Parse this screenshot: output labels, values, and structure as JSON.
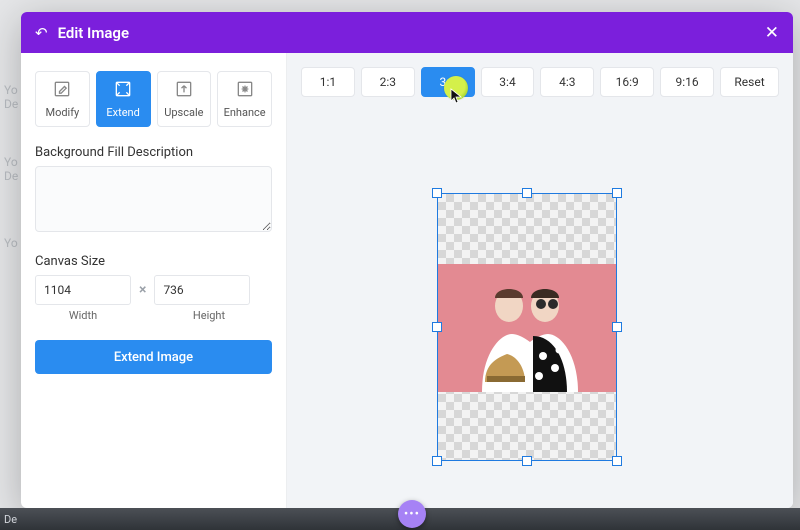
{
  "header": {
    "title": "Edit Image"
  },
  "bg": {
    "t1": "Yo",
    "t2": "De",
    "t3": "Yo",
    "t4": "De",
    "t5": "Yo",
    "footleft": "De"
  },
  "tools": {
    "modify": "Modify",
    "extend": "Extend",
    "upscale": "Upscale",
    "enhance": "Enhance",
    "active": "extend"
  },
  "form": {
    "desc_label": "Background Fill Description",
    "desc_value": "",
    "canvas_label": "Canvas Size",
    "width_value": "1104",
    "height_value": "736",
    "width_label": "Width",
    "height_label": "Height",
    "submit": "Extend Image"
  },
  "ratios": {
    "items": [
      "1:1",
      "2:3",
      "3:2",
      "3:4",
      "4:3",
      "16:9",
      "9:16"
    ],
    "reset": "Reset",
    "active_index": 2
  },
  "footer": {
    "orb": "•••"
  }
}
